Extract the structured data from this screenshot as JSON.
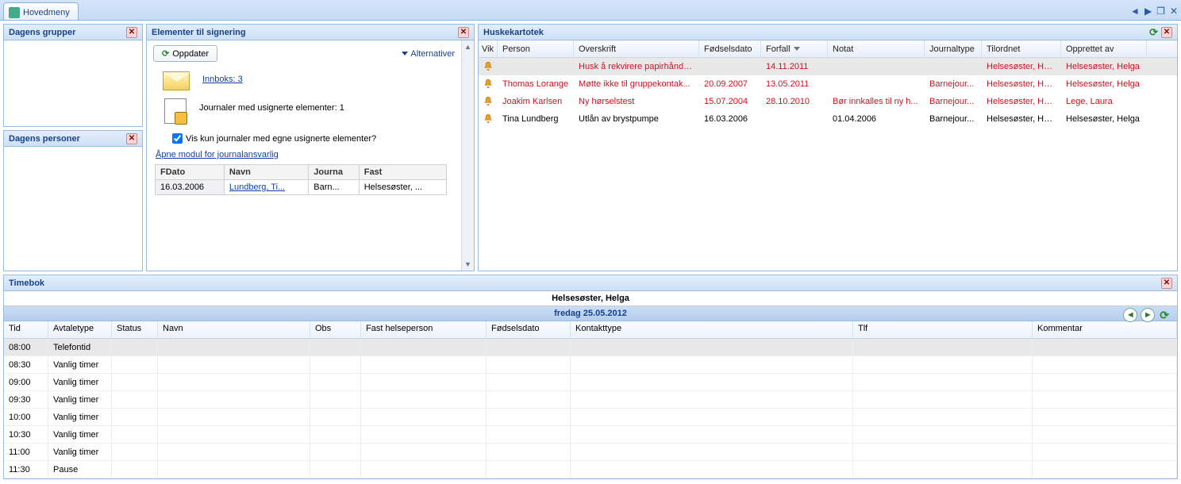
{
  "tab": {
    "label": "Hovedmeny"
  },
  "panels": {
    "grupper": {
      "title": "Dagens grupper"
    },
    "personer": {
      "title": "Dagens personer"
    },
    "elementer": {
      "title": "Elementer til signering",
      "oppdater": "Oppdater",
      "alternativer": "Alternativer",
      "innboks": "Innboks: 3",
      "journaler_line": "Journaler med usignerte elementer: 1",
      "checkbox_label": "Vis kun journaler med egne usignerte elementer?",
      "apne_modul": "Åpne modul for journalansvarlig",
      "cols": {
        "fdato": "FDato",
        "navn": "Navn",
        "journa": "Journa",
        "fast": "Fast"
      },
      "rows": [
        {
          "fdato": "16.03.2006",
          "navn": "Lundberg, Ti...",
          "journa": "Barn...",
          "fast": "Helsesøster, ..."
        }
      ]
    },
    "huske": {
      "title": "Huskekartotek",
      "cols": {
        "vik": "Vik",
        "person": "Person",
        "overskrift": "Overskrift",
        "fod": "Fødselsdato",
        "forfall": "Forfall",
        "notat": "Notat",
        "jtype": "Journaltype",
        "tilordnet": "Tilordnet",
        "opprettet": "Opprettet av"
      },
      "rows": [
        {
          "red": true,
          "selected": true,
          "person": "",
          "overskrift": "Husk å rekvirere papirhåndk...",
          "fod": "",
          "forfall": "14.11.2011",
          "notat": "",
          "jtype": "",
          "tilordnet": "Helsesøster, Helga",
          "opprettet": "Helsesøster, Helga"
        },
        {
          "red": true,
          "person": "Thomas Lorange",
          "overskrift": "Møtte ikke til gruppekontak...",
          "fod": "20.09.2007",
          "forfall": "13.05.2011",
          "notat": "",
          "jtype": "Barnejour...",
          "tilordnet": "Helsesøster, Helga",
          "opprettet": "Helsesøster, Helga"
        },
        {
          "red": true,
          "person": "Joakim Karlsen",
          "overskrift": "Ny hørselstest",
          "fod": "15.07.2004",
          "forfall": "28.10.2010",
          "notat": "Bør innkalles til ny h...",
          "jtype": "Barnejour...",
          "tilordnet": "Helsesøster, Helga",
          "opprettet": "Lege, Laura"
        },
        {
          "red": false,
          "person": "Tina Lundberg",
          "overskrift": "Utlån av brystpumpe",
          "fod": "16.03.2006",
          "forfall": "",
          "notat": "01.04.2006",
          "jtype": "Barnejour...",
          "tilordnet": "Helsesøster, Helga",
          "opprettet": "Helsesøster, Helga"
        }
      ]
    },
    "timebok": {
      "title": "Timebok",
      "owner": "Helsesøster, Helga",
      "date": "fredag 25.05.2012",
      "cols": {
        "tid": "Tid",
        "avtale": "Avtaletype",
        "status": "Status",
        "navn": "Navn",
        "obs": "Obs",
        "fast": "Fast helseperson",
        "fod": "Fødselsdato",
        "kont": "Kontakttype",
        "tlf": "Tlf",
        "kom": "Kommentar"
      },
      "rows": [
        {
          "tid": "08:00",
          "avtale": "Telefontid",
          "selected": true
        },
        {
          "tid": "08:30",
          "avtale": "Vanlig timer"
        },
        {
          "tid": "09:00",
          "avtale": "Vanlig timer"
        },
        {
          "tid": "09:30",
          "avtale": "Vanlig timer"
        },
        {
          "tid": "10:00",
          "avtale": "Vanlig timer"
        },
        {
          "tid": "10:30",
          "avtale": "Vanlig timer"
        },
        {
          "tid": "11:00",
          "avtale": "Vanlig timer"
        },
        {
          "tid": "11:30",
          "avtale": "Pause"
        }
      ]
    }
  }
}
